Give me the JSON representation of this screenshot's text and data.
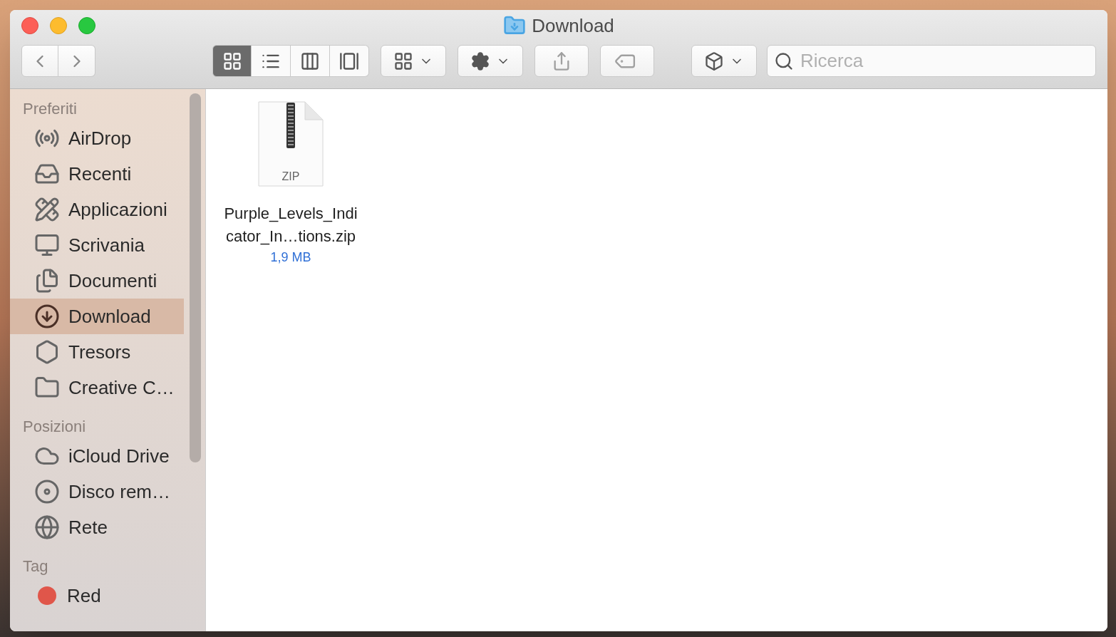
{
  "window": {
    "title": "Download"
  },
  "toolbar": {
    "view_modes": [
      {
        "selected": true
      },
      {
        "selected": false
      },
      {
        "selected": false
      },
      {
        "selected": false
      }
    ],
    "search": {
      "placeholder": "Ricerca"
    }
  },
  "sidebar": {
    "sections": [
      {
        "title": "Preferiti",
        "items": [
          {
            "label": "AirDrop",
            "selected": false
          },
          {
            "label": "Recenti",
            "selected": false
          },
          {
            "label": "Applicazioni",
            "selected": false
          },
          {
            "label": "Scrivania",
            "selected": false
          },
          {
            "label": "Documenti",
            "selected": false
          },
          {
            "label": "Download",
            "selected": true
          },
          {
            "label": "Tresors",
            "selected": false
          },
          {
            "label": "Creative C…",
            "selected": false
          }
        ]
      },
      {
        "title": "Posizioni",
        "items": [
          {
            "label": "iCloud Drive",
            "selected": false
          },
          {
            "label": "Disco rem…",
            "selected": false
          },
          {
            "label": "Rete",
            "selected": false
          }
        ]
      },
      {
        "title": "Tag",
        "items": [
          {
            "label": "Red",
            "selected": false,
            "color": "#e0564a"
          }
        ]
      }
    ]
  },
  "files": [
    {
      "type_label": "ZIP",
      "name": "Purple_Levels_Indicator_In…tions.zip",
      "size": "1,9 MB"
    }
  ]
}
